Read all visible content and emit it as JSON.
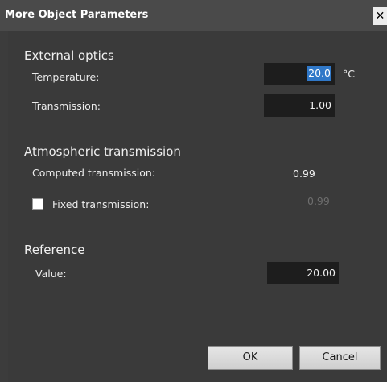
{
  "window": {
    "title": "More Object Parameters",
    "close_glyph": "✕"
  },
  "external_optics": {
    "heading": "External optics",
    "temperature": {
      "label": "Temperature:",
      "value": "20.0",
      "unit": "°C"
    },
    "transmission": {
      "label": "Transmission:",
      "value": "1.00"
    }
  },
  "atmospheric_transmission": {
    "heading": "Atmospheric transmission",
    "computed": {
      "label": "Computed transmission:",
      "value": "0.99"
    },
    "fixed": {
      "label": "Fixed transmission:",
      "checked": false,
      "value": "0.99"
    }
  },
  "reference": {
    "heading": "Reference",
    "value_label": "Value:",
    "value": "20.00"
  },
  "buttons": {
    "ok": "OK",
    "cancel": "Cancel"
  },
  "colors": {
    "window_background": "#3c3c3c",
    "titlebar": "#4a4a4a",
    "field_background": "#1d1d1d",
    "selection": "#3078c8",
    "disabled_text": "#6e6e6e"
  }
}
